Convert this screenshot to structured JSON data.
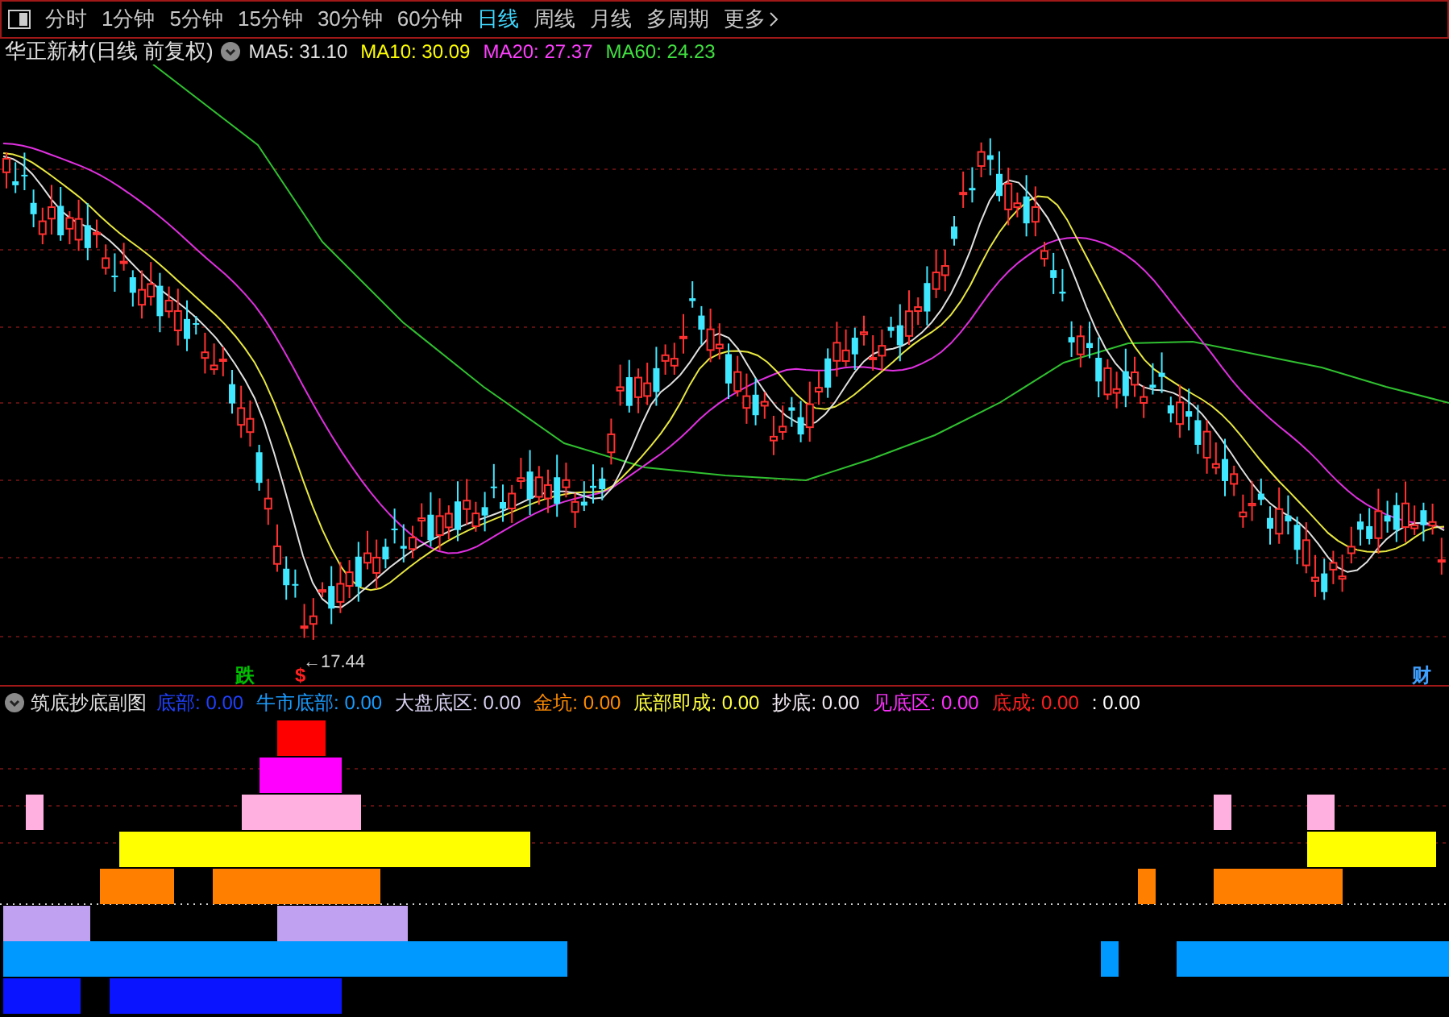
{
  "toolbar": {
    "tabs": [
      {
        "label": "分时",
        "selected": false
      },
      {
        "label": "1分钟",
        "selected": false
      },
      {
        "label": "5分钟",
        "selected": false
      },
      {
        "label": "15分钟",
        "selected": false
      },
      {
        "label": "30分钟",
        "selected": false
      },
      {
        "label": "60分钟",
        "selected": false
      },
      {
        "label": "日线",
        "selected": true
      },
      {
        "label": "周线",
        "selected": false
      },
      {
        "label": "月线",
        "selected": false
      },
      {
        "label": "多周期",
        "selected": false
      }
    ],
    "more": "更多"
  },
  "main_chart": {
    "title": "华正新材(日线 前复权)",
    "moving_averages": [
      {
        "label": "MA5: 31.10",
        "color": "#e0e0e0"
      },
      {
        "label": "MA10: 30.09",
        "color": "#ffff00"
      },
      {
        "label": "MA20: 27.37",
        "color": "#ff40ff"
      },
      {
        "label": "MA60: 24.23",
        "color": "#40e040"
      }
    ],
    "low_label": "←17.44",
    "markers": [
      {
        "text": "跌",
        "color": "#00c000"
      },
      {
        "text": "$",
        "color": "#ff2020"
      },
      {
        "text": "财",
        "color": "#40a0ff"
      }
    ]
  },
  "indicator": {
    "title": "筑底抄底副图",
    "items": [
      {
        "label": "底部:",
        "value": "0.00",
        "color": "#2040ff"
      },
      {
        "label": "牛市底部:",
        "value": "0.00",
        "color": "#1a9cff"
      },
      {
        "label": "大盘底区:",
        "value": "0.00",
        "color": "#d8d0f0"
      },
      {
        "label": "金坑:",
        "value": "0.00",
        "color": "#ff8c00"
      },
      {
        "label": "底部即成:",
        "value": "0.00",
        "color": "#ffff40"
      },
      {
        "label": "抄底:",
        "value": "0.00",
        "color": "#f0e8f0"
      },
      {
        "label": "见底区:",
        "value": "0.00",
        "color": "#ff30ff"
      },
      {
        "label": "底成:",
        "value": "0.00",
        "color": "#ff2020"
      },
      {
        "label": ":",
        "value": "0.00",
        "color": "#ffffff"
      }
    ]
  }
}
